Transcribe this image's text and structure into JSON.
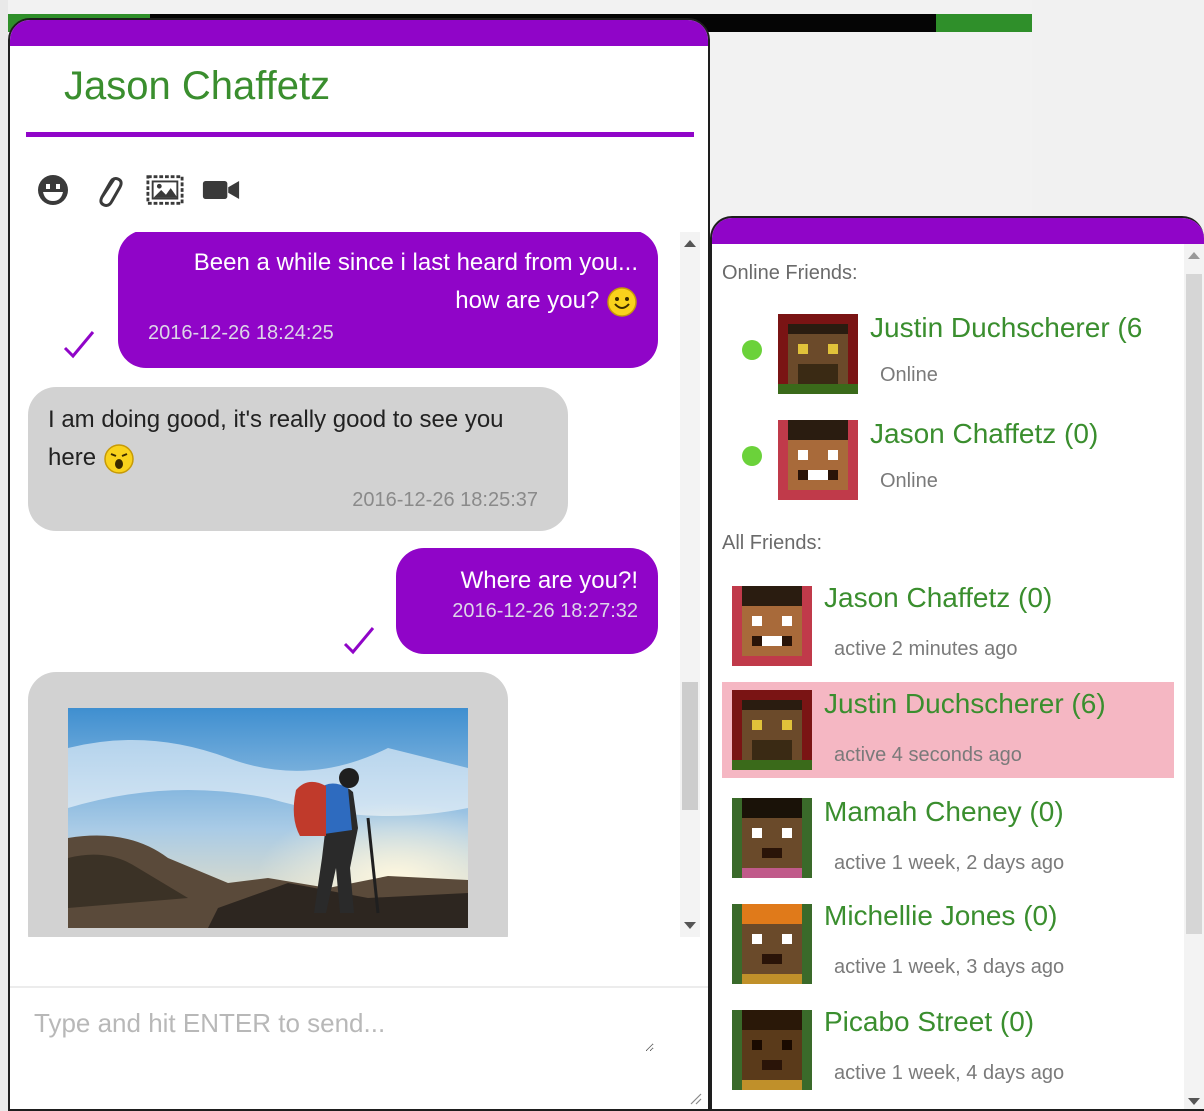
{
  "chat": {
    "title": "Jason Chaffetz",
    "toolbar": [
      {
        "icon": "smiley-icon"
      },
      {
        "icon": "paperclip-icon"
      },
      {
        "icon": "image-icon"
      },
      {
        "icon": "video-camera-icon"
      }
    ],
    "messages": [
      {
        "direction": "outgoing",
        "line1": "Been a while since i last heard from you...",
        "line2": "how are you?",
        "emoji": "smile-emoji",
        "time": "2016-12-26 18:24:25",
        "read": true
      },
      {
        "direction": "incoming",
        "line1": "I am doing good, it's really good to see you",
        "line2": "here",
        "emoji": "surprised-emoji",
        "time": "2016-12-26 18:25:37"
      },
      {
        "direction": "outgoing",
        "line1": "Where are you?!",
        "time": "2016-12-26 18:27:32",
        "read": true
      },
      {
        "direction": "incoming",
        "type": "image",
        "image": "hiker-on-mountain-photo"
      }
    ],
    "input_placeholder": "Type and hit ENTER to send..."
  },
  "friends": {
    "online_label": "Online Friends:",
    "online": [
      {
        "name": "Justin Duchscherer (6",
        "status": "Online",
        "avatar": "pixel-avatar-justin"
      },
      {
        "name": "Jason Chaffetz (0)",
        "status": "Online",
        "avatar": "pixel-avatar-jason"
      }
    ],
    "all_label": "All Friends:",
    "all": [
      {
        "name": "Jason Chaffetz (0)",
        "status": "active 2 minutes ago",
        "avatar": "pixel-avatar-jason"
      },
      {
        "name": "Justin Duchscherer (6)",
        "status": "active 4 seconds ago",
        "avatar": "pixel-avatar-justin",
        "highlighted": true
      },
      {
        "name": "Mamah Cheney (0)",
        "status": "active 1 week, 2 days ago",
        "avatar": "pixel-avatar-mamah"
      },
      {
        "name": "Michellie Jones (0)",
        "status": "active 1 week, 3 days ago",
        "avatar": "pixel-avatar-michellie"
      },
      {
        "name": "Picabo Street (0)",
        "status": "active 1 week, 4 days ago",
        "avatar": "pixel-avatar-picabo"
      }
    ]
  },
  "colors": {
    "accent": "#9005c8",
    "name_green": "#3a8e2e",
    "incoming_bubble": "#d2d2d2",
    "online_dot": "#6bd23a",
    "highlight_row": "#f5b7c3"
  }
}
